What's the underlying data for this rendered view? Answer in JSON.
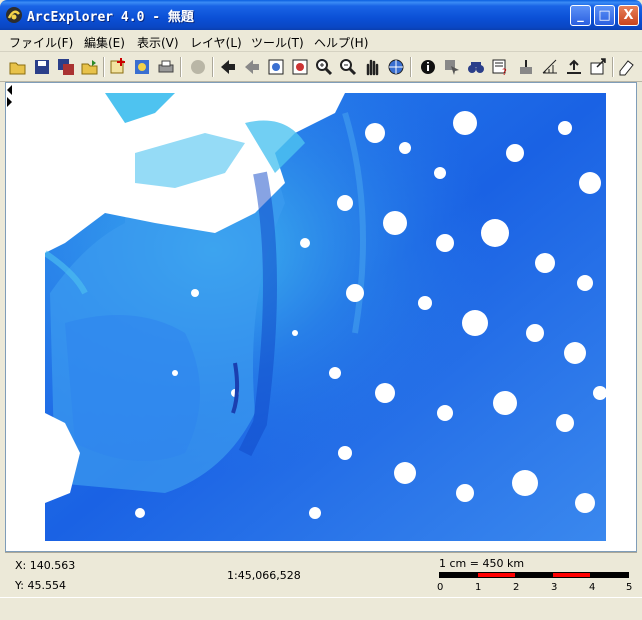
{
  "window": {
    "title": "ArcExplorer 4.0 - 無題",
    "minimize_label": "_",
    "maximize_label": "□",
    "close_label": "X"
  },
  "menu": [
    {
      "label": "ファイル(F)"
    },
    {
      "label": "編集(E)"
    },
    {
      "label": "表示(V)"
    },
    {
      "label": "レイヤ(L)"
    },
    {
      "label": "ツール(T)"
    },
    {
      "label": "ヘルプ(H)"
    }
  ],
  "toolbar": {
    "icons": [
      "open-folder-icon",
      "save-icon",
      "save-all-icon",
      "open-project-icon",
      "add-layer-icon",
      "add-data-icon",
      "print-icon",
      "stop-icon",
      "back-icon",
      "forward-icon",
      "full-extent-icon",
      "zoom-layer-icon",
      "zoom-in-icon",
      "zoom-out-icon",
      "pan-icon",
      "globe-pan-icon",
      "identify-icon",
      "select-icon",
      "find-icon",
      "query-icon",
      "measure-icon",
      "scale-icon",
      "chart-icon",
      "export-icon",
      "properties-icon",
      "eraser-icon"
    ]
  },
  "status": {
    "x": "X: 140.563",
    "y": "Y: 45.554",
    "scale": "1:45,066,528",
    "scalebar_label": "1 cm = 450 km",
    "ticks": [
      "0",
      "1",
      "2",
      "3",
      "4",
      "5"
    ],
    "colors": {
      "dark": "#000000",
      "accent": "#ff0000"
    }
  },
  "map": {
    "water_color": "#1f6fe8",
    "shelf_color": "#4ec3f0",
    "land_color": "#ffffff"
  }
}
